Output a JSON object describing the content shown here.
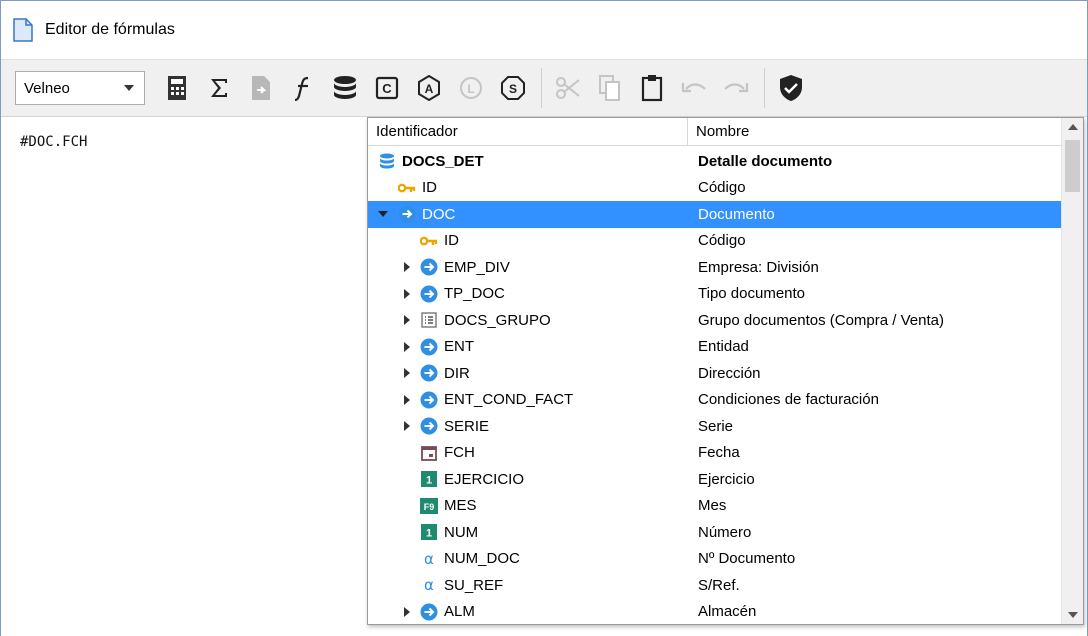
{
  "window": {
    "title": "Editor de fórmulas"
  },
  "toolbar": {
    "combo_value": "Velneo",
    "icons": [
      "calculator-icon",
      "sigma-icon",
      "document-arrow-icon",
      "function-icon",
      "database-icon",
      "c-badge-icon",
      "a-badge-icon",
      "l-badge-icon",
      "s-badge-icon",
      "cut-icon",
      "copy-icon",
      "paste-icon",
      "undo-icon",
      "redo-icon",
      "shield-check-icon"
    ]
  },
  "editor": {
    "text": "#DOC.FCH"
  },
  "popup": {
    "col_id": "Identificador",
    "col_name": "Nombre",
    "rows": [
      {
        "id": "DOCS_DET",
        "name": "Detalle documento",
        "icon": "database",
        "level": 0,
        "expander": "none",
        "bold": true
      },
      {
        "id": "ID",
        "name": "Código",
        "icon": "key",
        "level": 1,
        "expander": "none"
      },
      {
        "id": "DOC",
        "name": "Documento",
        "icon": "link",
        "level": 1,
        "expander": "down",
        "selected": true
      },
      {
        "id": "ID",
        "name": "Código",
        "icon": "key",
        "level": 2,
        "expander": "none"
      },
      {
        "id": "EMP_DIV",
        "name": "Empresa: División",
        "icon": "link",
        "level": 2,
        "expander": "right"
      },
      {
        "id": "TP_DOC",
        "name": "Tipo documento",
        "icon": "link",
        "level": 2,
        "expander": "right"
      },
      {
        "id": "DOCS_GRUPO",
        "name": "Grupo documentos (Compra / Venta)",
        "icon": "list",
        "level": 2,
        "expander": "right"
      },
      {
        "id": "ENT",
        "name": "Entidad",
        "icon": "link",
        "level": 2,
        "expander": "right"
      },
      {
        "id": "DIR",
        "name": "Dirección",
        "icon": "link",
        "level": 2,
        "expander": "right"
      },
      {
        "id": "ENT_COND_FACT",
        "name": "Condiciones de facturación",
        "icon": "link",
        "level": 2,
        "expander": "right"
      },
      {
        "id": "SERIE",
        "name": "Serie",
        "icon": "link",
        "level": 2,
        "expander": "right"
      },
      {
        "id": "FCH",
        "name": "Fecha",
        "icon": "calendar",
        "level": 2,
        "expander": "none"
      },
      {
        "id": "EJERCICIO",
        "name": "Ejercicio",
        "icon": "number",
        "level": 2,
        "expander": "none"
      },
      {
        "id": "MES",
        "name": "Mes",
        "icon": "f9",
        "level": 2,
        "expander": "none"
      },
      {
        "id": "NUM",
        "name": "Número",
        "icon": "number",
        "level": 2,
        "expander": "none"
      },
      {
        "id": "NUM_DOC",
        "name": "Nº Documento",
        "icon": "alpha",
        "level": 2,
        "expander": "none"
      },
      {
        "id": "SU_REF",
        "name": "S/Ref.",
        "icon": "alpha",
        "level": 2,
        "expander": "none"
      },
      {
        "id": "ALM",
        "name": "Almacén",
        "icon": "link",
        "level": 2,
        "expander": "right"
      }
    ]
  },
  "colors": {
    "selection": "#3390ff",
    "link_icon": "#2f8fe3",
    "key_icon": "#e8a800",
    "number_icon": "#1e8a70"
  }
}
